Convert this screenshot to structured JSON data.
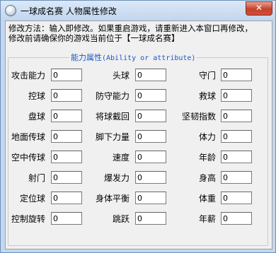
{
  "window": {
    "title": "一球成名赛 人物属性修改",
    "close_label": "✕",
    "app_icon": "soccer-ball-icon"
  },
  "instructions": {
    "line1": "修改方法：输入即修改。如果重启游戏，请重新进入本窗口再修改，",
    "line2": "修改前请确保你的游戏当前位于【一球成名赛】"
  },
  "group": {
    "title_cn": "能力属性",
    "title_en": "(Ability or attribute)"
  },
  "fields": [
    {
      "label": "攻击能力",
      "value": "0"
    },
    {
      "label": "头球",
      "value": "0"
    },
    {
      "label": "守门",
      "value": "0"
    },
    {
      "label": "控球",
      "value": "0"
    },
    {
      "label": "防守能力",
      "value": "0"
    },
    {
      "label": "救球",
      "value": "0"
    },
    {
      "label": "盘球",
      "value": "0"
    },
    {
      "label": "将球截回",
      "value": "0"
    },
    {
      "label": "坚韧指数",
      "value": "0"
    },
    {
      "label": "地面传球",
      "value": "0"
    },
    {
      "label": "脚下力量",
      "value": "0"
    },
    {
      "label": "体力",
      "value": "0"
    },
    {
      "label": "空中传球",
      "value": "0"
    },
    {
      "label": "速度",
      "value": "0"
    },
    {
      "label": "年龄",
      "value": "0"
    },
    {
      "label": "射门",
      "value": "0"
    },
    {
      "label": "爆发力",
      "value": "0"
    },
    {
      "label": "身高",
      "value": "0"
    },
    {
      "label": "定位球",
      "value": "0"
    },
    {
      "label": "身体平衡",
      "value": "0"
    },
    {
      "label": "体重",
      "value": "0"
    },
    {
      "label": "控制旋转",
      "value": "0"
    },
    {
      "label": "跳跃",
      "value": "0"
    },
    {
      "label": "年薪",
      "value": "0"
    }
  ]
}
